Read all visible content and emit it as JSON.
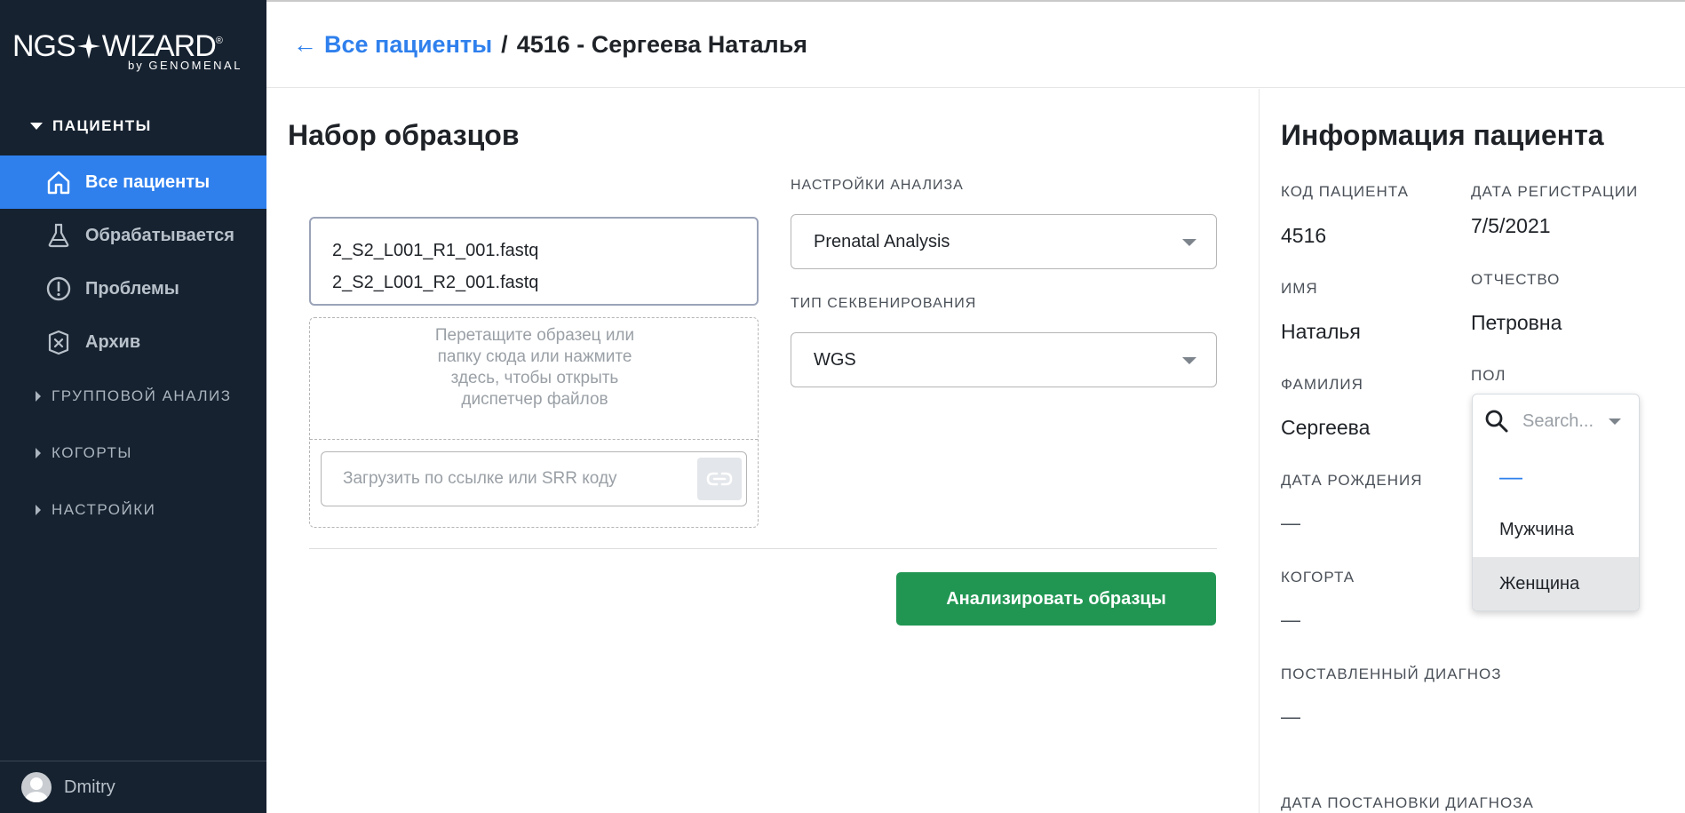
{
  "sidebar": {
    "logo_left": "NGS",
    "logo_right": "WIZARD",
    "logo_reg": "®",
    "logo_by": "by",
    "logo_brand": "GENOMENAL",
    "patients_section": "ПАЦИЕНТЫ",
    "items": [
      {
        "label": "Все пациенты",
        "icon": "home-icon",
        "active": true
      },
      {
        "label": "Обрабатывается",
        "icon": "flask-icon",
        "active": false
      },
      {
        "label": "Проблемы",
        "icon": "alert-icon",
        "active": false
      },
      {
        "label": "Архив",
        "icon": "archive-icon",
        "active": false
      }
    ],
    "sections": [
      {
        "label": "ГРУППОВОЙ АНАЛИЗ"
      },
      {
        "label": "КОГОРТЫ"
      },
      {
        "label": "НАСТРОЙКИ"
      }
    ],
    "user_name": "Dmitry"
  },
  "header": {
    "back_arrow": "←",
    "breadcrumb_link": "Все пациенты",
    "separator": "/",
    "current": "4516 - Сергеева Наталья"
  },
  "main": {
    "title": "Набор образцов",
    "files": [
      "2_S2_L001_R1_001.fastq",
      "2_S2_L001_R2_001.fastq"
    ],
    "drop_text": "Перетащите образец или папку сюда или нажмите здесь, чтобы открыть диспетчер файлов",
    "url_placeholder": "Загрузить по ссылке или SRR коду",
    "analysis_settings_label": "НАСТРОЙКИ АНАЛИЗА",
    "analysis_settings_value": "Prenatal Analysis",
    "sequencing_type_label": "ТИП СЕКВЕНИРОВАНИЯ",
    "sequencing_type_value": "WGS",
    "analyze_button": "Анализировать образцы"
  },
  "patient": {
    "title": "Информация пациента",
    "code_label": "КОД ПАЦИЕНТА",
    "code_value": "4516",
    "reg_date_label": "ДАТА РЕГИСТРАЦИИ",
    "reg_date_value": "7/5/2021",
    "first_name_label": "ИМЯ",
    "first_name_value": "Наталья",
    "patronymic_label": "ОТЧЕСТВО",
    "patronymic_value": "Петровна",
    "last_name_label": "ФАМИЛИЯ",
    "last_name_value": "Сергеева",
    "sex_label": "ПОЛ",
    "birth_date_label": "ДАТА РОЖДЕНИЯ",
    "birth_date_value": "—",
    "cohort_label": "КОГОРТА",
    "cohort_value": "—",
    "diagnosis_label": "ПОСТАВЛЕННЫЙ ДИАГНОЗ",
    "diagnosis_value": "—",
    "diagnosis_date_label": "ДАТА ПОСТАНОВКИ ДИАГНОЗА"
  },
  "sex_dropdown": {
    "search_placeholder": "Search...",
    "options": [
      "—",
      "Мужчина",
      "Женщина"
    ],
    "highlighted": "Женщина"
  },
  "colors": {
    "sidebar_bg": "#162230",
    "accent": "#2f80ed",
    "primary_button": "#219653"
  }
}
